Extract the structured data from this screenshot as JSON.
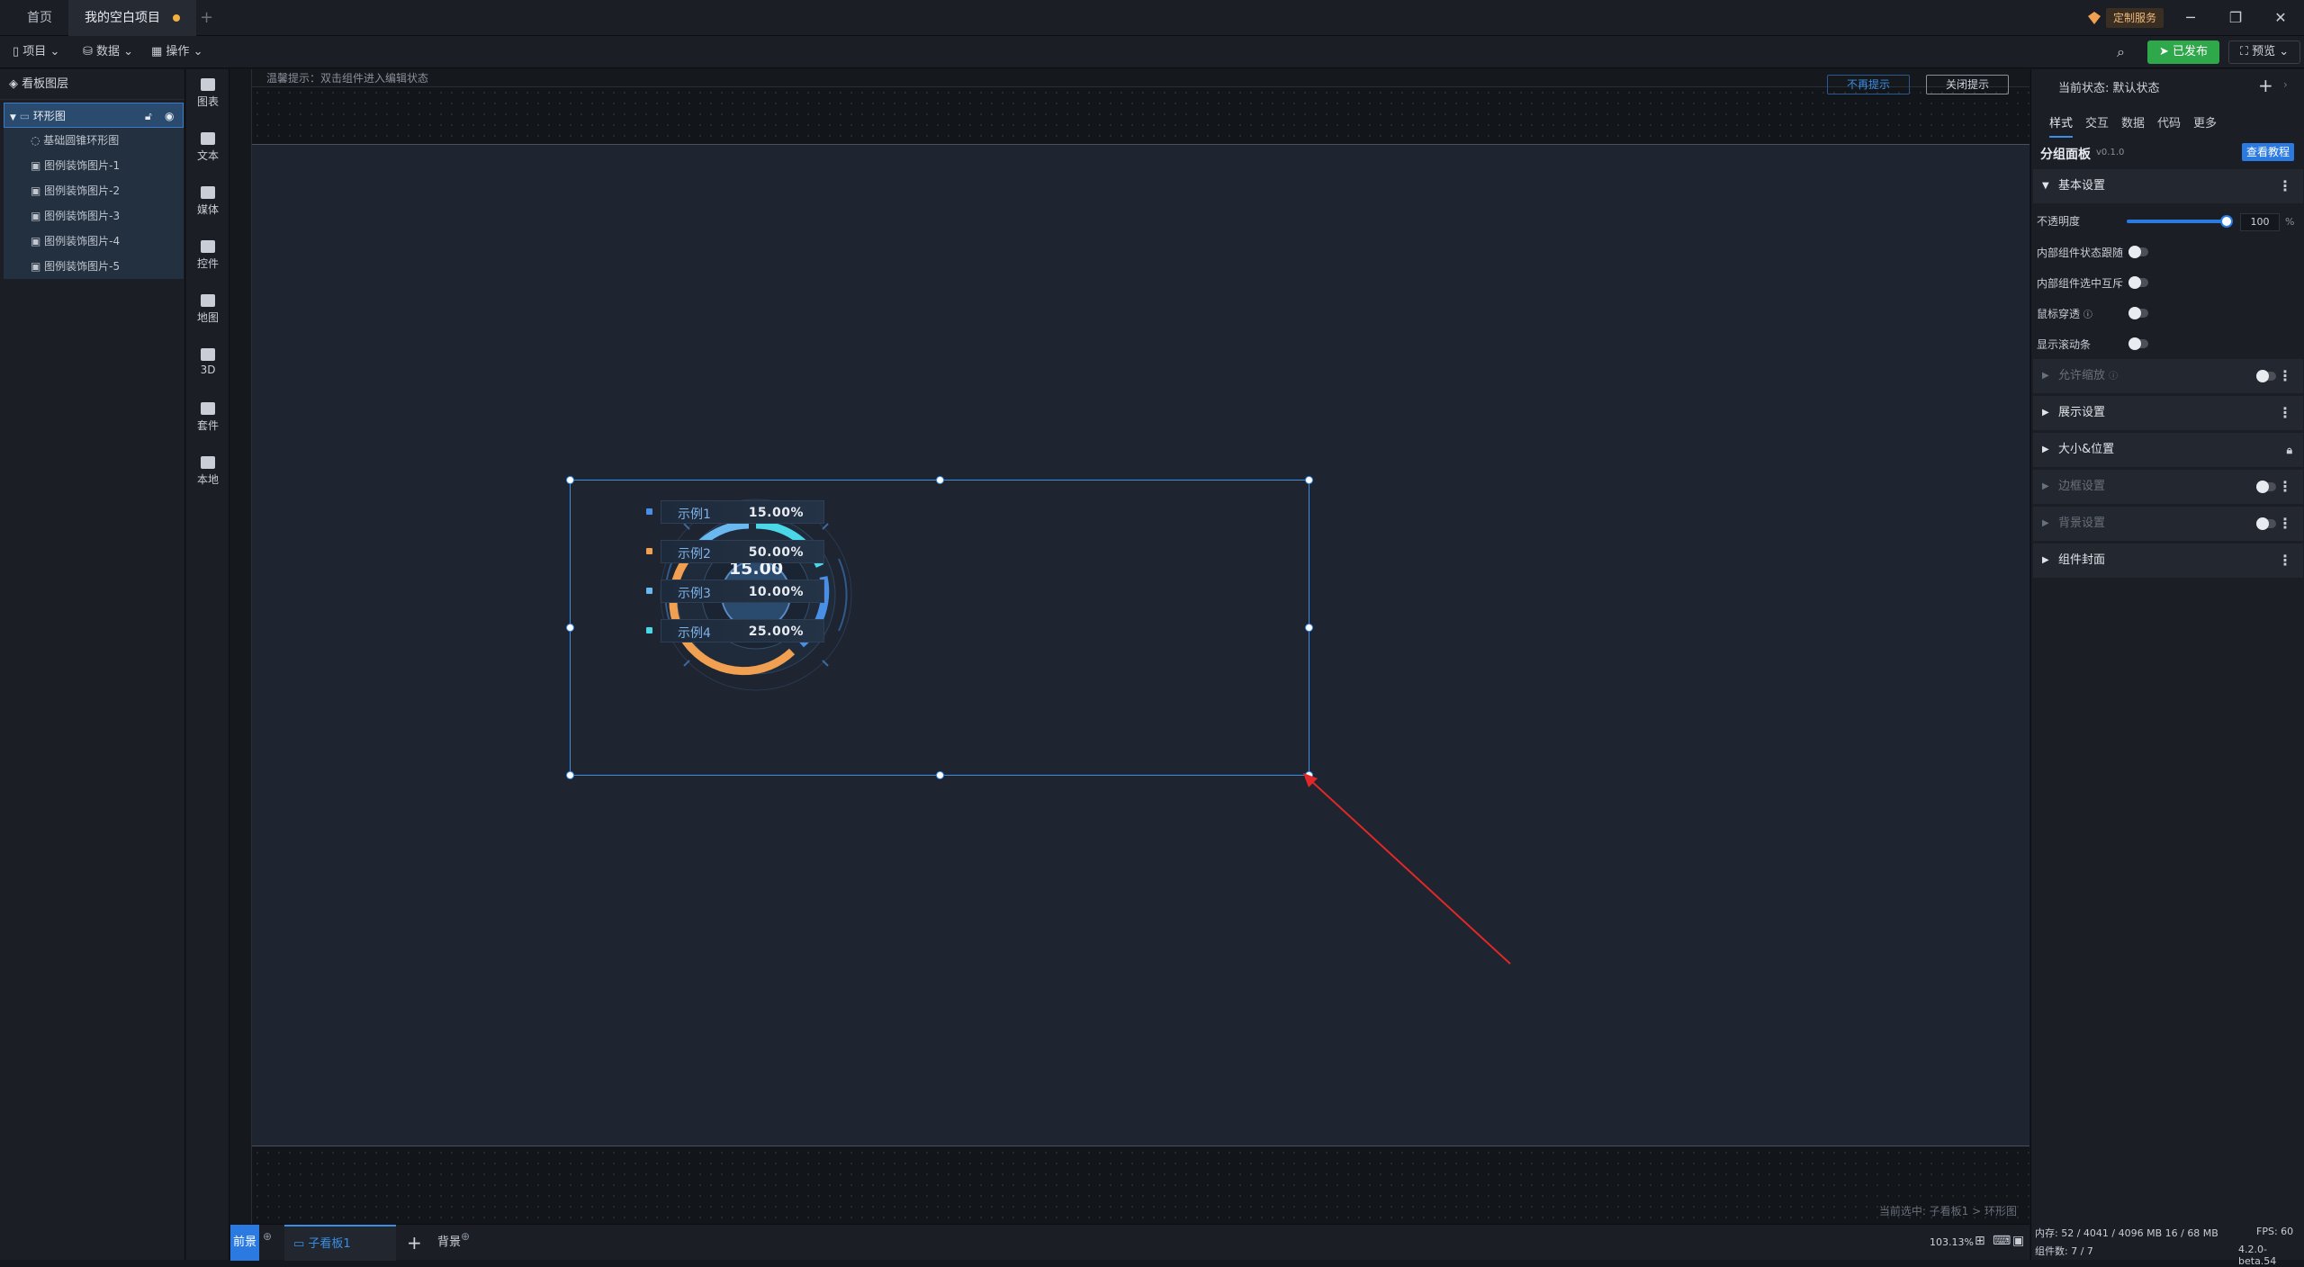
{
  "topbar": {
    "tabs": [
      "首页",
      "我的空白项目"
    ],
    "custom_service": "定制服务"
  },
  "toolbar": {
    "project": "项目",
    "data": "数据",
    "operate": "操作",
    "publish": "已发布",
    "preview": "预览"
  },
  "layers": {
    "title": "看板图层",
    "group": "环形图",
    "items": [
      "基础圆锥环形图",
      "图例装饰图片-1",
      "图例装饰图片-2",
      "图例装饰图片-3",
      "图例装饰图片-4",
      "图例装饰图片-5"
    ]
  },
  "components": [
    "图表",
    "文本",
    "媒体",
    "控件",
    "地图",
    "3D",
    "套件",
    "本地"
  ],
  "canvas": {
    "hint": "温馨提示：双击组件进入编辑状态",
    "no_more_hint": "不再提示",
    "close_hint": "关闭提示",
    "current_selection": "当前选中: 子看板1 > 环形图",
    "donut": {
      "center_value": "15.00",
      "center_unit": "%",
      "legend": [
        {
          "name": "示例1",
          "value": "15.00%",
          "color": "#4a8fe6"
        },
        {
          "name": "示例2",
          "value": "50.00%",
          "color": "#f0a050"
        },
        {
          "name": "示例3",
          "value": "10.00%",
          "color": "#6ab8f0"
        },
        {
          "name": "示例4",
          "value": "25.00%",
          "color": "#4ad8e8"
        }
      ]
    }
  },
  "bottombar": {
    "foreground": "前景",
    "subboard": "子看板1",
    "background": "背景",
    "zoom": "103.13%"
  },
  "rightpanel": {
    "current_state_label": "当前状态:",
    "current_state": "默认状态",
    "tabs": [
      "样式",
      "交互",
      "数据",
      "代码",
      "更多"
    ],
    "component_name": "分组面板",
    "version": "v0.1.0",
    "tutorial": "查看教程",
    "sections": {
      "basic": "基本设置",
      "allow_scale": "允许缩放",
      "display": "展示设置",
      "size_position": "大小&位置",
      "border": "边框设置",
      "background": "背景设置",
      "cover": "组件封面"
    },
    "props": {
      "opacity": "不透明度",
      "opacity_value": "100",
      "opacity_unit": "%",
      "inner_follow": "内部组件状态跟随",
      "inner_mutex": "内部组件选中互斥",
      "mouse_through": "鼠标穿透",
      "show_scrollbar": "显示滚动条"
    },
    "status": {
      "memory": "内存: 52 / 4041 / 4096 MB  16 / 68 MB",
      "fps": "FPS: 60",
      "components": "组件数: 7 / 7",
      "version": "4.2.0-beta.54"
    }
  }
}
